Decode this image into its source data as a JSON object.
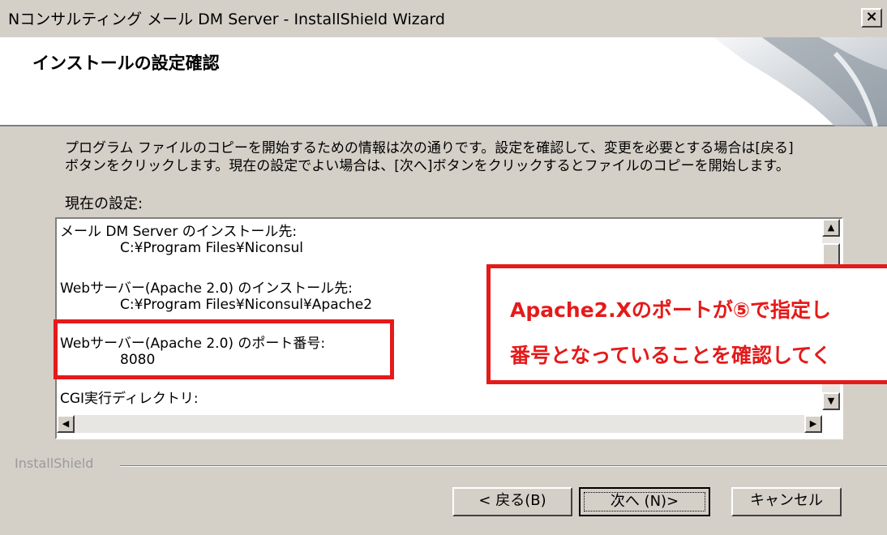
{
  "window": {
    "title": "Nコンサルティング メール DM Server - InstallShield Wizard",
    "close_label": "×"
  },
  "header": {
    "title": "インストールの設定確認"
  },
  "description": {
    "line1": "プログラム ファイルのコピーを開始するための情報は次の通りです。設定を確認して、変更を必要とする場合は[戻る]",
    "line2": "ボタンをクリックします。現在の設定でよい場合は、[次へ]ボタンをクリックするとファイルのコピーを開始します。"
  },
  "current_settings_label": "現在の設定:",
  "settings": [
    {
      "label": "メール DM Server のインストール先:",
      "value": "C:¥Program Files¥Niconsul"
    },
    {
      "label": "Webサーバー(Apache 2.0) のインストール先:",
      "value": "C:¥Program Files¥Niconsul¥Apache2"
    },
    {
      "label": "Webサーバー(Apache 2.0) のポート番号:",
      "value": "8080"
    },
    {
      "label": "CGI実行ディレクトリ:",
      "value": ""
    }
  ],
  "callout": {
    "line1": "Apache2.Xのポートが⑤で指定し",
    "line2": "番号となっていることを確認してく",
    "color": "#e51a1a"
  },
  "footer": {
    "brand": "InstallShield",
    "back_label": "< 戻る(B)",
    "next_label": "次へ (N)>",
    "cancel_label": "キャンセル"
  }
}
